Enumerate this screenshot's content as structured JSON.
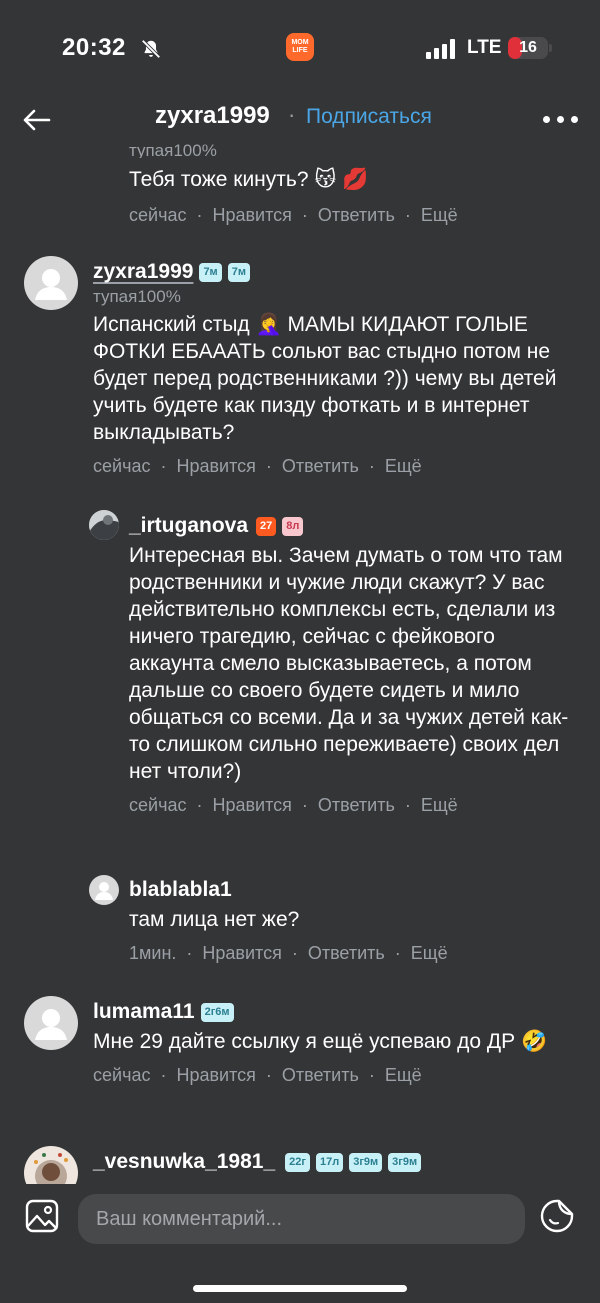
{
  "status_bar": {
    "time": "20:32",
    "app_logo_text": "MOM LIFE",
    "network": "LTE",
    "battery": "16",
    "battery_fraction": 0.16
  },
  "nav": {
    "title": "zyxra1999",
    "separator": "·",
    "follow_label": "Подписаться"
  },
  "actions": {
    "like": "Нравится",
    "reply": "Ответить",
    "more": "Ещё",
    "sep": "·"
  },
  "comments": [
    {
      "reply_to": "тупая100%",
      "text": "Тебя тоже кинуть? 😽 💋",
      "time": "сейчас"
    },
    {
      "username": "zyxra1999",
      "badges": [
        "7м",
        "7м"
      ],
      "reply_to": "тупая100%",
      "text": "Испанский стыд 🤦‍♀️ МАМЫ КИДАЮТ ГОЛЫЕ ФОТКИ ЕБАААТЬ сольют вас стыдно потом не будет перед родственниками ?)) чему вы детей учить будете как пизду фоткать и в интернет выкладывать?",
      "time": "сейчас"
    },
    {
      "username": "_irtuganova",
      "badges": [
        "27",
        "8л"
      ],
      "text": "Интересная вы. Зачем думать о том что там родственники и чужие люди скажут? У вас действительно комплексы есть, сделали из ничего трагедию, сейчас с фейкового аккаунта смело высказываетесь, а потом дальше со своего будете сидеть и мило общаться со всеми. Да и за чужих детей как-то слишком сильно переживаете) своих дел нет чтоли?)",
      "time": "сейчас"
    },
    {
      "username": "blablabla1",
      "text": "там лица нет же?",
      "time": "1мин."
    },
    {
      "username": "lumama11",
      "badges": [
        "2г6м"
      ],
      "text": "Мне 29 дайте ссылку я ещё успеваю до ДР 🤣",
      "time": "сейчас"
    },
    {
      "username": "_vesnuwka_1981_",
      "badges": [
        "22г",
        "17л",
        "3г9м",
        "3г9м"
      ]
    }
  ],
  "composer": {
    "placeholder": "Ваш комментарий..."
  }
}
